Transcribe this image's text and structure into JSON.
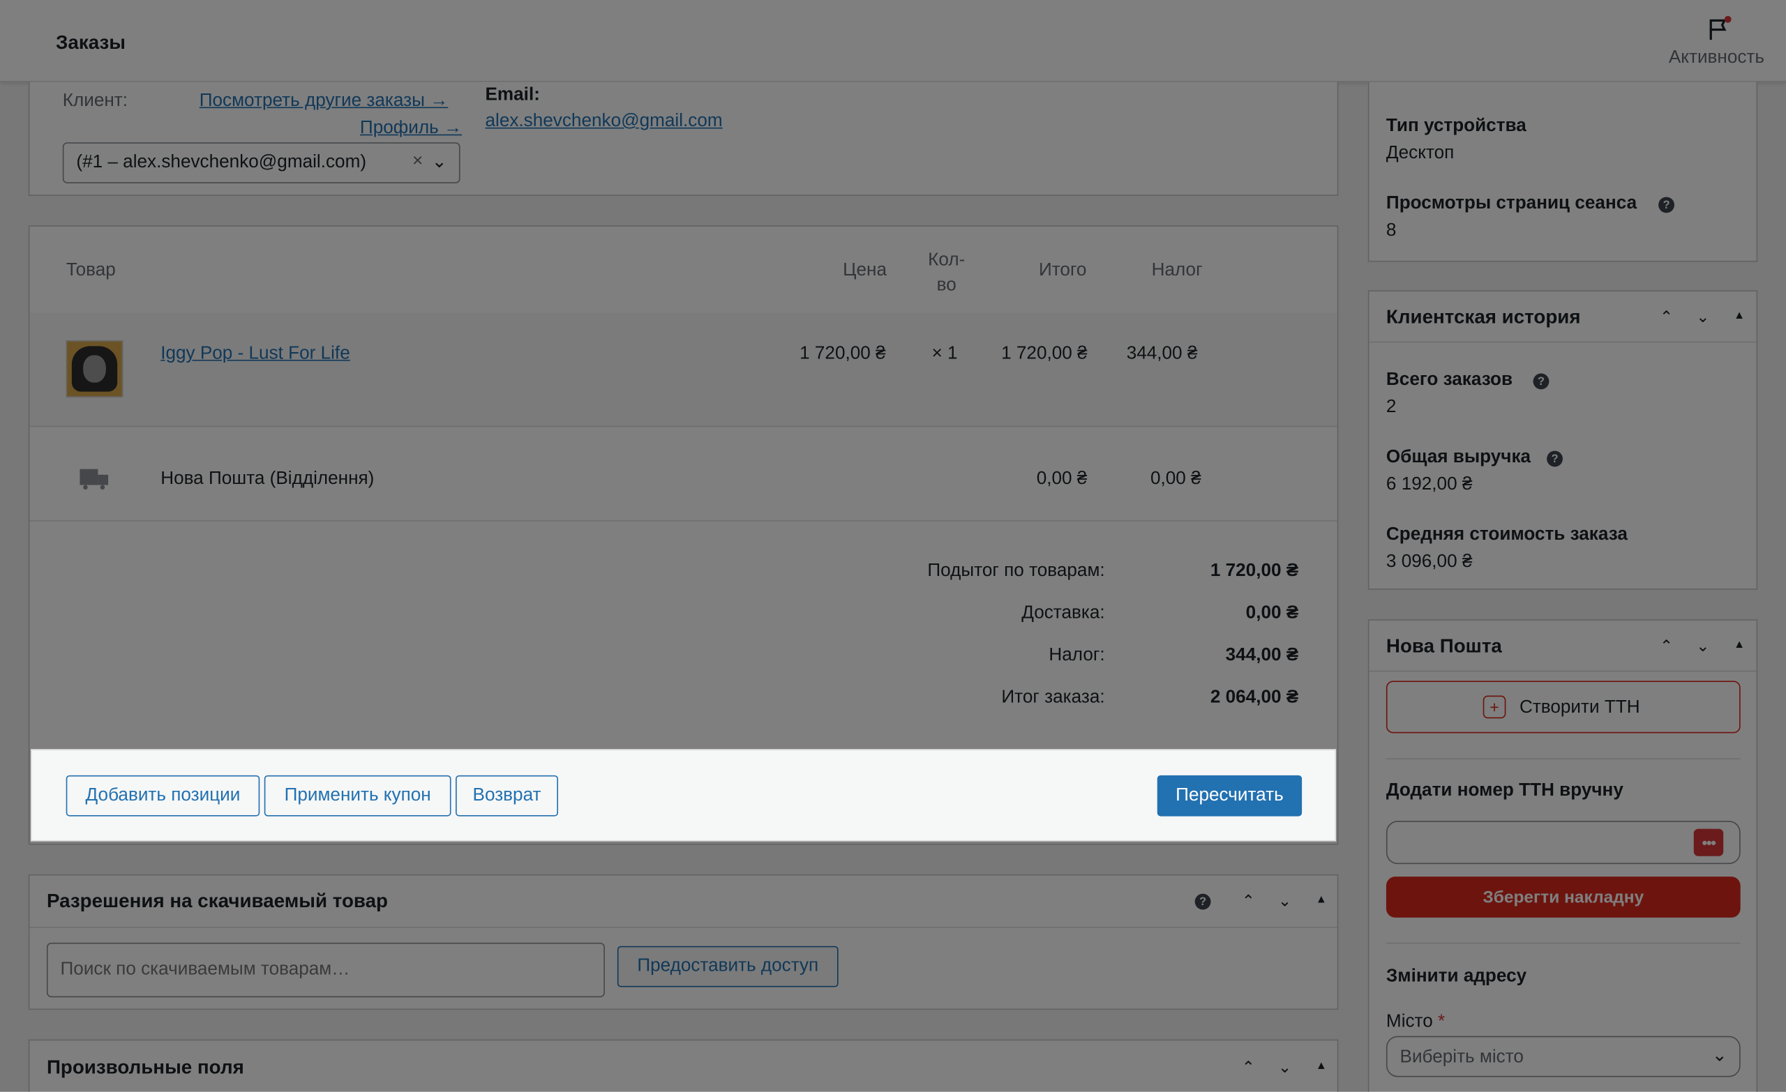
{
  "topbar": {
    "title": "Заказы",
    "activity_label": "Активность"
  },
  "customer": {
    "label": "Клиент:",
    "other_orders_link": "Посмотреть другие заказы →",
    "profile_link": "Профиль →",
    "selected": "(#1 – alex.shevchenko@gmail.com)",
    "email_label": "Email:",
    "email": "alex.shevchenko@gmail.com"
  },
  "items": {
    "headers": {
      "product": "Товар",
      "price": "Цена",
      "qty": "Кол-во",
      "total": "Итого",
      "tax": "Налог"
    },
    "product": {
      "name": "Iggy Pop - Lust For Life",
      "price": "1 720,00 ₴",
      "qty": "× 1",
      "total": "1 720,00 ₴",
      "tax": "344,00 ₴"
    },
    "shipping": {
      "name": "Нова Пошта (Відділення)",
      "total": "0,00 ₴",
      "tax": "0,00 ₴"
    },
    "totals": [
      {
        "label": "Подытог по товарам:",
        "value": "1 720,00 ₴"
      },
      {
        "label": "Доставка:",
        "value": "0,00 ₴"
      },
      {
        "label": "Налог:",
        "value": "344,00 ₴"
      },
      {
        "label": "Итог заказа:",
        "value": "2 064,00 ₴"
      }
    ]
  },
  "actions": {
    "add_items": "Добавить позиции",
    "apply_coupon": "Применить купон",
    "refund": "Возврат",
    "recalculate": "Пересчитать"
  },
  "downloads": {
    "title": "Разрешения на скачиваемый товар",
    "search_placeholder": "Поиск по скачиваемым товарам…",
    "grant": "Предоставить доступ"
  },
  "custom_fields": {
    "title": "Произвольные поля"
  },
  "attribution": {
    "device_label": "Тип устройства",
    "device_value": "Десктоп",
    "pageviews_label": "Просмотры страниц сеанса",
    "pageviews_value": "8"
  },
  "history": {
    "title": "Клиентская история",
    "total_orders_label": "Всего заказов",
    "total_orders_value": "2",
    "revenue_label": "Общая выручка",
    "revenue_value": "6 192,00 ₴",
    "avg_label": "Средняя стоимость заказа",
    "avg_value": "3 096,00 ₴"
  },
  "novaposhta": {
    "title": "Нова Пошта",
    "create_ttn": "Створити ТТН",
    "manual_label": "Додати номер ТТН вручну",
    "save_button": "Зберегти накладну",
    "change_address": "Змінити адресу",
    "city_label": "Місто",
    "required_mark": "*",
    "city_placeholder": "Виберіть місто"
  },
  "colors": {
    "primary": "#2271b1",
    "novaposhta_accent": "#da291c",
    "overlay": "rgba(0,0,0,0.5)"
  }
}
